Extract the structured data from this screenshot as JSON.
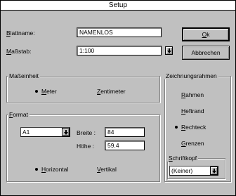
{
  "window": {
    "title": "Setup"
  },
  "fields": {
    "blattname": {
      "label_u": "B",
      "label_rest": "lattname:",
      "value": "NAMENLOS"
    },
    "massstab": {
      "label_u": "M",
      "label_rest": "aßstab:",
      "value": "1:100"
    }
  },
  "buttons": {
    "ok": {
      "u": "O",
      "rest": "k"
    },
    "abbrechen": {
      "label": "Abbrechen"
    }
  },
  "masseinheit": {
    "title": "Maßeinheit",
    "options": [
      {
        "u": "M",
        "rest": "eter",
        "selected": true
      },
      {
        "u": "Z",
        "rest": "entimeter",
        "selected": false
      }
    ]
  },
  "format": {
    "title_u": "F",
    "title_rest": "ormat",
    "paper": "A1",
    "breite": {
      "label": "Breite :",
      "value": "84"
    },
    "hoehe": {
      "label": "Höhe :",
      "value": "59.4"
    },
    "orientation": [
      {
        "u": "H",
        "rest": "orizontal",
        "selected": true
      },
      {
        "u": "V",
        "rest": "ertikal",
        "selected": false
      }
    ]
  },
  "zeichnungsrahmen": {
    "title": "Zeichnungsrahmen",
    "options": [
      {
        "u": "R",
        "rest": "ahmen",
        "selected": false
      },
      {
        "u": "H",
        "rest": "eftrand",
        "selected": false
      },
      {
        "u": "R",
        "rest": "echteck",
        "selected": true
      },
      {
        "u": "G",
        "rest": "renzen",
        "selected": false
      }
    ]
  },
  "schriftkopf": {
    "title_u": "S",
    "title_rest": "chriftkopf",
    "value": "(Keiner)"
  },
  "icons": {
    "dropdown": "chevron-down-icon",
    "radio": "radio-button-icon"
  }
}
